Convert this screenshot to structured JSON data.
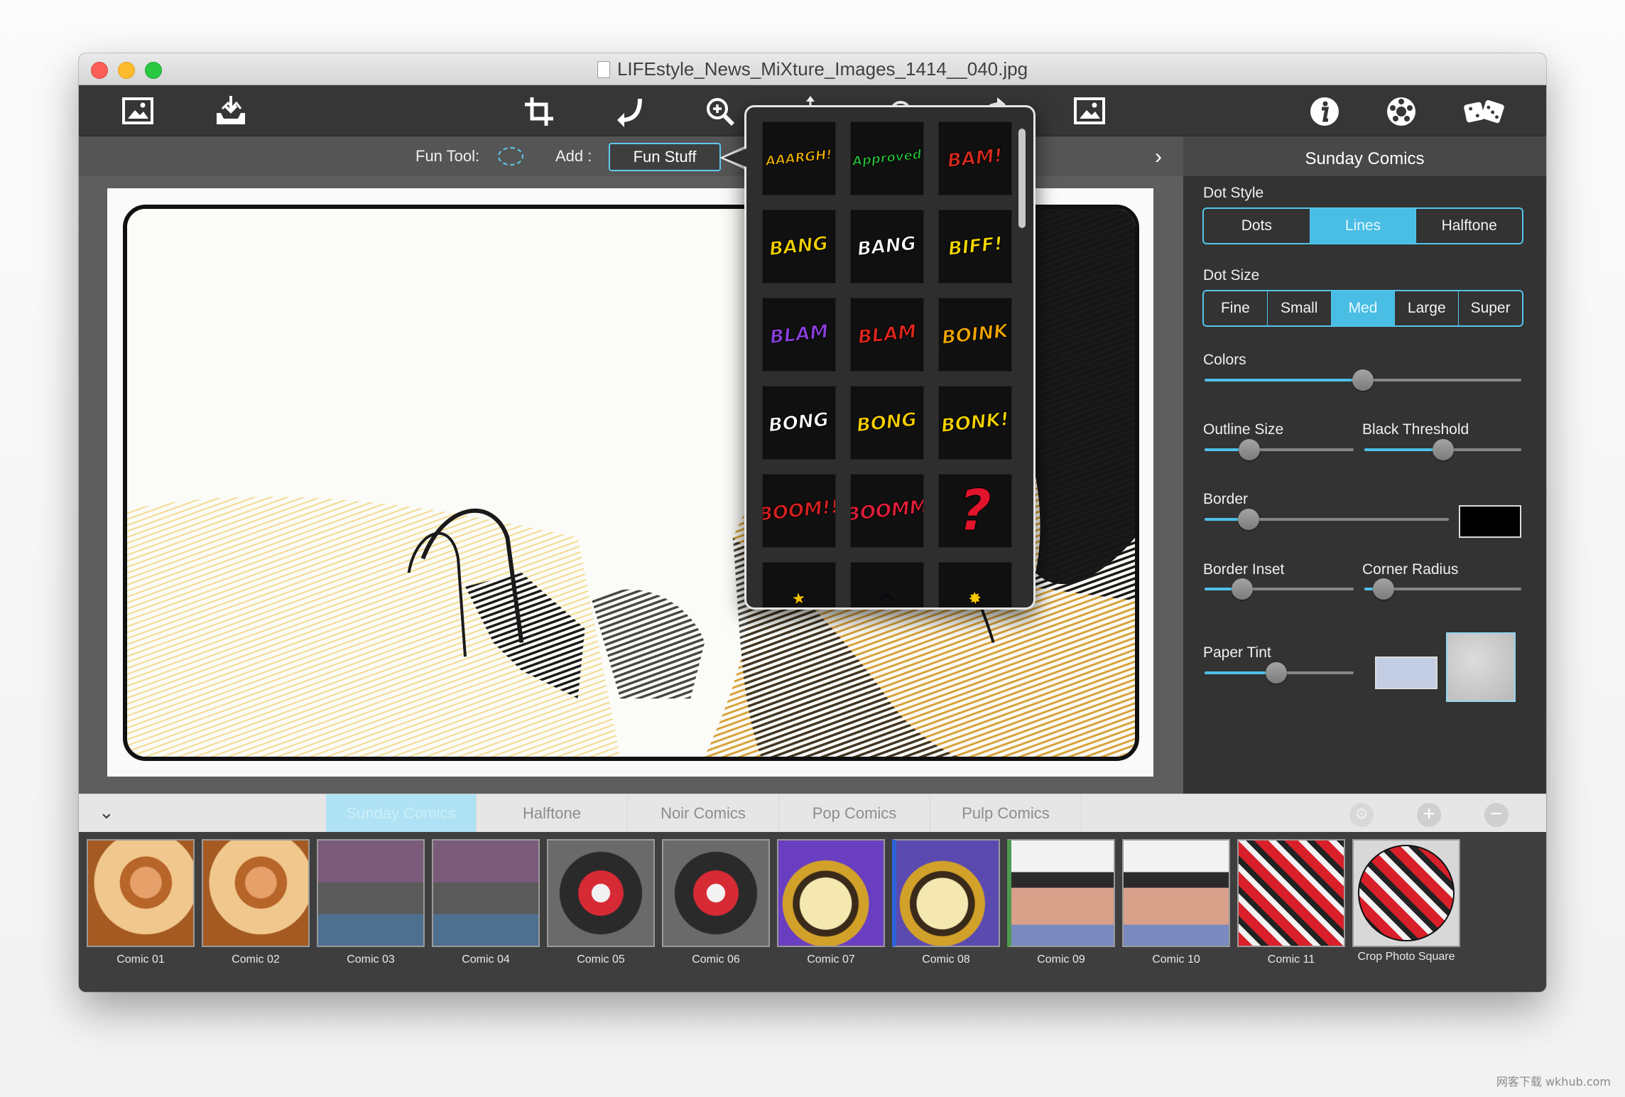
{
  "window": {
    "title": "LIFEstyle_News_MiXture_Images_1414__040.jpg"
  },
  "toolbar": {
    "icons": [
      "open-image-icon",
      "save-image-icon",
      "crop-icon",
      "rotate-icon",
      "zoom-icon",
      "move-icon",
      "undo-icon",
      "redo-icon",
      "compare-image-icon",
      "info-icon",
      "settings-icon",
      "random-dice-icon"
    ]
  },
  "options": {
    "fun_tool_label": "Fun Tool:",
    "add_label": "Add :",
    "fun_stuff_button": "Fun Stuff"
  },
  "panel": {
    "title": "Sunday Comics",
    "dot_style": {
      "label": "Dot Style",
      "options": [
        "Dots",
        "Lines",
        "Halftone"
      ],
      "selected": "Lines"
    },
    "dot_size": {
      "label": "Dot Size",
      "options": [
        "Fine",
        "Small",
        "Med",
        "Large",
        "Super"
      ],
      "selected": "Med"
    },
    "colors": {
      "label": "Colors",
      "value": 0.5
    },
    "outline_size": {
      "label": "Outline Size",
      "value": 0.3
    },
    "black_threshold": {
      "label": "Black Threshold",
      "value": 0.5
    },
    "border": {
      "label": "Border",
      "value": 0.18,
      "color": "#000000"
    },
    "border_inset": {
      "label": "Border Inset",
      "value": 0.25
    },
    "corner_radius": {
      "label": "Corner Radius",
      "value": 0.12
    },
    "paper_tint": {
      "label": "Paper Tint",
      "value": 0.48,
      "color": "#c3cde4"
    }
  },
  "stickers": [
    {
      "name": "aaargh",
      "text": "AAARGH!",
      "color": "#f5b400"
    },
    {
      "name": "approved",
      "text": "Approved",
      "color": "#27c23a"
    },
    {
      "name": "bam",
      "text": "BAM!",
      "color": "#d42a1c"
    },
    {
      "name": "bang-red",
      "text": "BANG",
      "color": "#f2d000"
    },
    {
      "name": "bang-white",
      "text": "BANG",
      "color": "#ffffff"
    },
    {
      "name": "biff",
      "text": "BIFF!",
      "color": "#f6d800"
    },
    {
      "name": "blam-purple",
      "text": "BLAM",
      "color": "#8a3fdc"
    },
    {
      "name": "blam-red",
      "text": "BLAM",
      "color": "#e0261c"
    },
    {
      "name": "boink",
      "text": "BOINK",
      "color": "#f0a400"
    },
    {
      "name": "bong-white",
      "text": "BONG",
      "color": "#ffffff"
    },
    {
      "name": "bong-yellow",
      "text": "BONG",
      "color": "#f7cf00"
    },
    {
      "name": "bonk",
      "text": "BONK!",
      "color": "#f5d300"
    },
    {
      "name": "boom",
      "text": "BOOM!!",
      "color": "#d42020"
    },
    {
      "name": "boomm",
      "text": "BOOMM",
      "color": "#e01f3a"
    },
    {
      "name": "question",
      "text": "?",
      "color": "#e0142b"
    }
  ],
  "tabs": {
    "items": [
      "Sunday Comics",
      "Halftone",
      "Noir Comics",
      "Pop Comics",
      "Pulp Comics"
    ],
    "selected": "Sunday Comics"
  },
  "presets": [
    {
      "label": "Comic 01"
    },
    {
      "label": "Comic 02"
    },
    {
      "label": "Comic 03"
    },
    {
      "label": "Comic 04"
    },
    {
      "label": "Comic 05"
    },
    {
      "label": "Comic 06"
    },
    {
      "label": "Comic 07"
    },
    {
      "label": "Comic 08"
    },
    {
      "label": "Comic 09"
    },
    {
      "label": "Comic 10"
    },
    {
      "label": "Comic 11"
    },
    {
      "label": "Crop Photo Square"
    }
  ],
  "watermark": "网客下载 wkhub.com",
  "accent": "#4ec0e8"
}
